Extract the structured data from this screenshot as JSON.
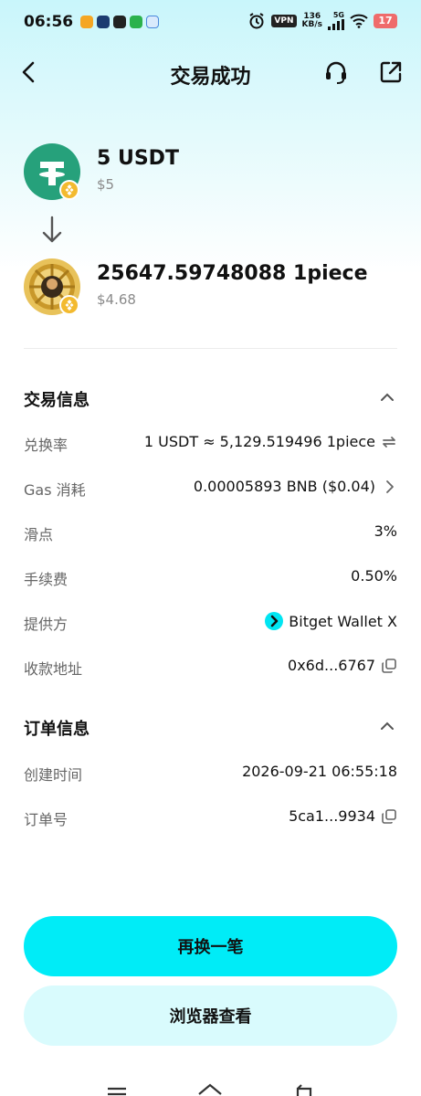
{
  "status_bar": {
    "time": "06:56",
    "vpn": "VPN",
    "speed_value": "136",
    "speed_unit": "KB/s",
    "network": "5G",
    "battery": "17"
  },
  "nav": {
    "title": "交易成功"
  },
  "from_token": {
    "amount": "5 USDT",
    "usd": "$5"
  },
  "to_token": {
    "amount": "25647.59748088 1piece",
    "usd": "$4.68"
  },
  "trade_info": {
    "title": "交易信息",
    "rows": [
      {
        "label": "兑换率",
        "value": "1 USDT ≈ 5,129.519496 1piece"
      },
      {
        "label": "Gas 消耗",
        "value": "0.00005893 BNB ($0.04)"
      },
      {
        "label": "滑点",
        "value": "3%"
      },
      {
        "label": "手续费",
        "value": "0.50%"
      },
      {
        "label": "提供方",
        "value": "Bitget Wallet X"
      },
      {
        "label": "收款地址",
        "value": "0x6d...6767"
      }
    ]
  },
  "order_info": {
    "title": "订单信息",
    "rows": [
      {
        "label": "创建时间",
        "value": "2026-09-21 06:55:18"
      },
      {
        "label": "订单号",
        "value": "5ca1...9934"
      }
    ]
  },
  "buttons": {
    "primary": "再换一笔",
    "secondary": "浏览器查看"
  },
  "colors": {
    "accent": "#00ecf7",
    "accent_light": "#d9fbfd",
    "usdt": "#26a17b",
    "bnb": "#f3ba2f"
  }
}
